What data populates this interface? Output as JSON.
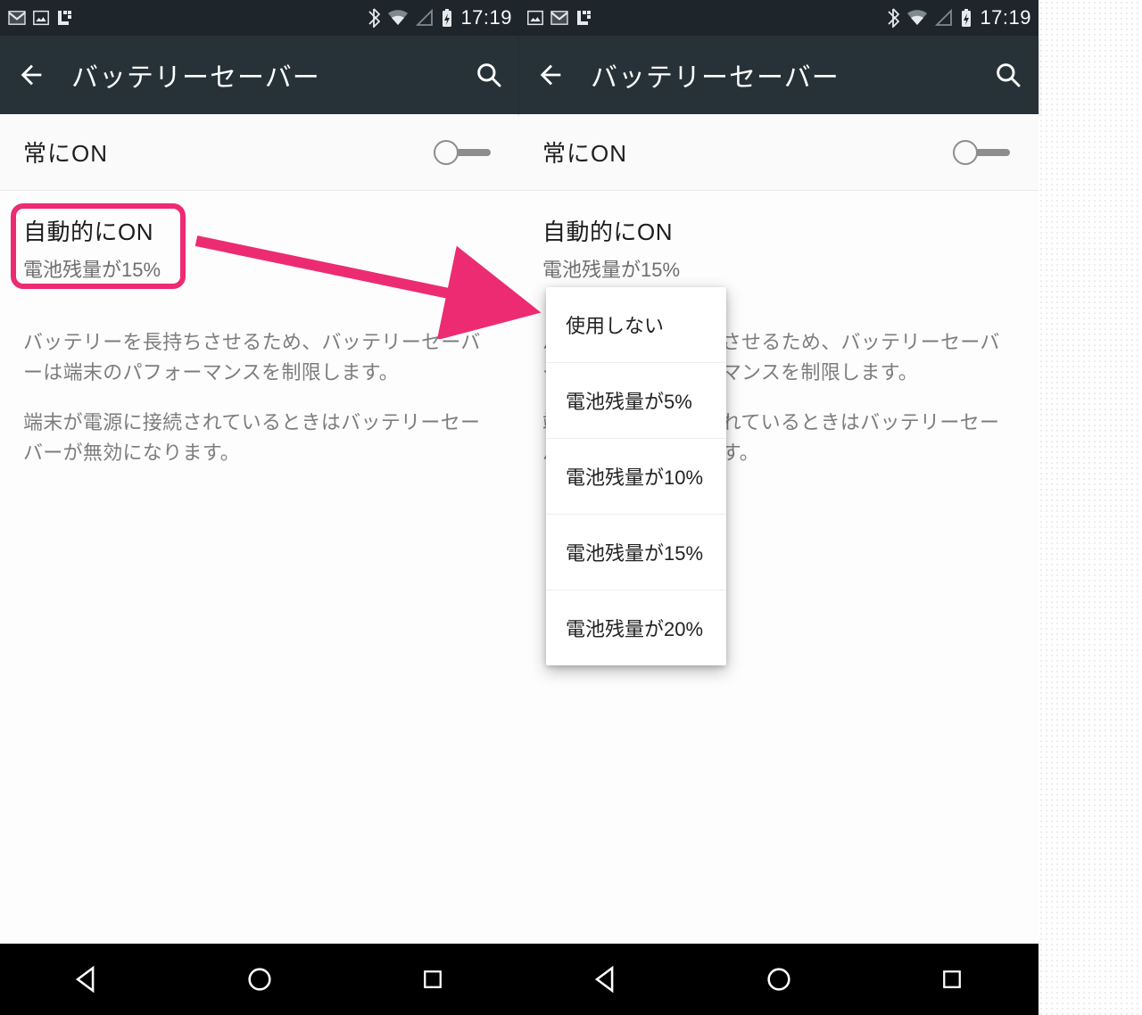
{
  "status": {
    "time": "17:19"
  },
  "appbar": {
    "title": "バッテリーセーバー"
  },
  "settings": {
    "always_on": "常にON",
    "auto_on_title": "自動的にON",
    "auto_on_sub": "電池残量が15%"
  },
  "desc": {
    "p1": "バッテリーを長持ちさせるため、バッテリーセーバーは端末のパフォーマンスを制限します。",
    "p2": "端末が電源に接続されているときはバッテリーセーバーが無効になります。"
  },
  "popup": {
    "opt0": "使用しない",
    "opt1": "電池残量が5%",
    "opt2": "電池残量が10%",
    "opt3": "電池残量が15%",
    "opt4": "電池残量が20%"
  },
  "colors": {
    "accent": "#ed2b72",
    "appbar": "#263238",
    "status": "#1f262b"
  }
}
